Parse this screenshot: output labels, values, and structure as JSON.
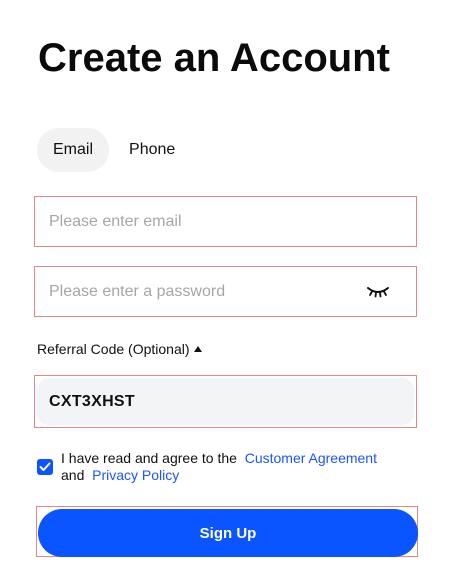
{
  "page": {
    "title": "Create an Account"
  },
  "tabs": [
    {
      "label": "Email",
      "active": true
    },
    {
      "label": "Phone",
      "active": false
    }
  ],
  "email": {
    "placeholder": "Please enter email",
    "value": ""
  },
  "password": {
    "placeholder": "Please enter a password",
    "value": "",
    "toggle_icon": "eye-closed-icon"
  },
  "referral": {
    "label": "Referral Code (Optional)",
    "caret_icon": "caret-up-icon",
    "value": "CXT3XHST"
  },
  "agreement": {
    "checked": true,
    "prefix": "I have read and agree to the",
    "link1": "Customer Agreement",
    "middle": "and",
    "link2": "Privacy Policy"
  },
  "signup": {
    "label": "Sign Up"
  },
  "colors": {
    "accent": "#0a55ff",
    "link": "#1a56ff",
    "highlight_border": "#e88585",
    "field_filled_bg": "#f3f4f6",
    "tab_active_bg": "#f2f2f2"
  }
}
